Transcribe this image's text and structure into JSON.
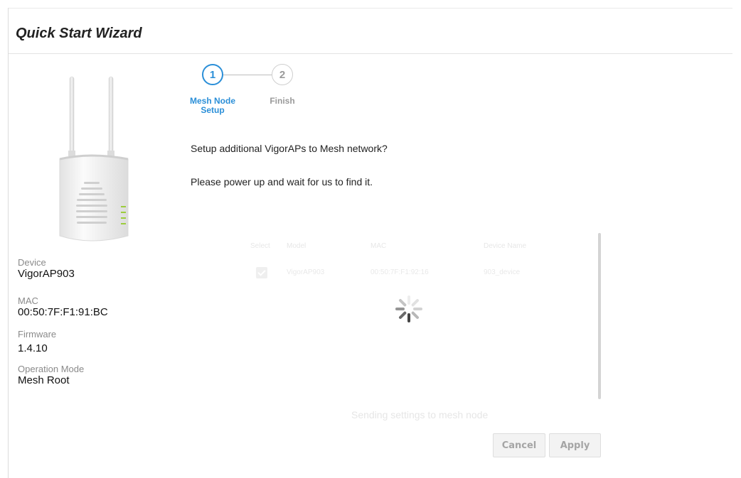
{
  "page": {
    "title": "Quick Start Wizard"
  },
  "device_info": [
    {
      "label": "Device",
      "value": "VigorAP903"
    },
    {
      "label": "MAC",
      "value": "00:50:7F:F1:91:BC"
    },
    {
      "label": "Firmware",
      "value": "1.4.10"
    },
    {
      "label": "Operation Mode",
      "value": "Mesh Root"
    }
  ],
  "wizard": {
    "steps": [
      {
        "number": "1",
        "label": "Mesh Node Setup",
        "state": "active"
      },
      {
        "number": "2",
        "label": "Finish",
        "state": "inactive"
      }
    ],
    "question": "Setup additional VigorAPs to Mesh network?",
    "instruction": "Please power up and wait for us to find it."
  },
  "table": {
    "headers": [
      "Select",
      "Model",
      "MAC",
      "Device Name"
    ],
    "rows": [
      {
        "selected": true,
        "model": "VigorAP903",
        "mac": "00:50:7F:F1:92:16",
        "device_name": "903_device"
      }
    ]
  },
  "status": {
    "text": "Sending settings to mesh node"
  },
  "buttons": {
    "cancel": "Cancel",
    "apply": "Apply"
  },
  "colors": {
    "accent": "#2b8fd8",
    "led": "#9ccc3c"
  },
  "icons": {
    "spinner": "loading-spinner-icon",
    "checkbox": "checkmark-icon"
  }
}
